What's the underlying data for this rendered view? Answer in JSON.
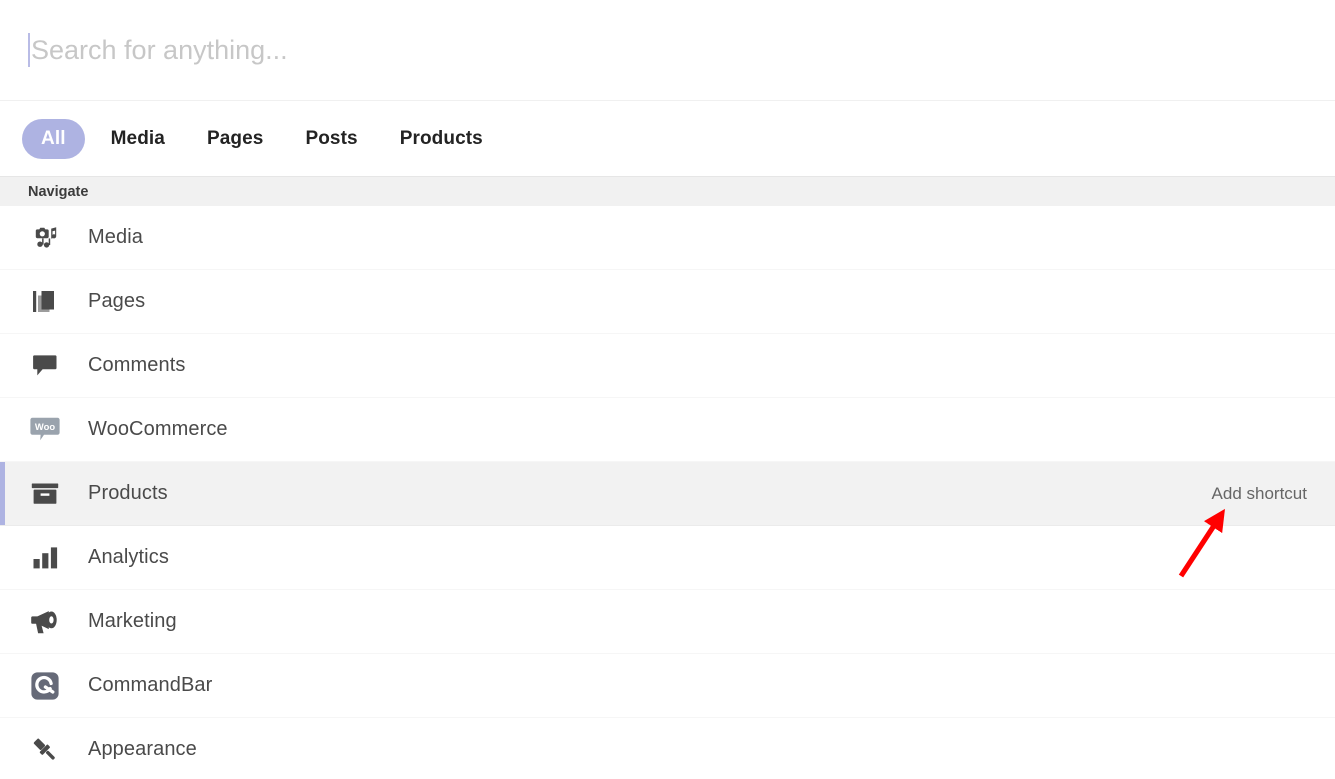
{
  "search": {
    "value": "",
    "placeholder": "Search for anything..."
  },
  "filters": {
    "tabs": [
      {
        "label": "All",
        "active": true
      },
      {
        "label": "Media",
        "active": false
      },
      {
        "label": "Pages",
        "active": false
      },
      {
        "label": "Posts",
        "active": false
      },
      {
        "label": "Products",
        "active": false
      }
    ]
  },
  "section": {
    "title": "Navigate"
  },
  "nav": {
    "items": [
      {
        "label": "Media",
        "icon": "camera-music-icon",
        "selected": false,
        "action": ""
      },
      {
        "label": "Pages",
        "icon": "pages-icon",
        "selected": false,
        "action": ""
      },
      {
        "label": "Comments",
        "icon": "comment-icon",
        "selected": false,
        "action": ""
      },
      {
        "label": "WooCommerce",
        "icon": "woo-icon",
        "selected": false,
        "action": ""
      },
      {
        "label": "Products",
        "icon": "archive-box-icon",
        "selected": true,
        "action": "Add shortcut"
      },
      {
        "label": "Analytics",
        "icon": "bar-chart-icon",
        "selected": false,
        "action": ""
      },
      {
        "label": "Marketing",
        "icon": "megaphone-icon",
        "selected": false,
        "action": ""
      },
      {
        "label": "CommandBar",
        "icon": "commandbar-icon",
        "selected": false,
        "action": ""
      },
      {
        "label": "Appearance",
        "icon": "paintbrush-icon",
        "selected": false,
        "action": ""
      }
    ]
  },
  "colors": {
    "accent": "#aeb3e2",
    "annotation": "#ff0000",
    "section_band": "#f1f1f1",
    "selected_row": "#f2f2f2",
    "icon": "#4a4a4a",
    "label": "#4a4a4a"
  },
  "annotation": {
    "type": "arrow",
    "color": "#ff0000",
    "points_to": "Add shortcut"
  }
}
